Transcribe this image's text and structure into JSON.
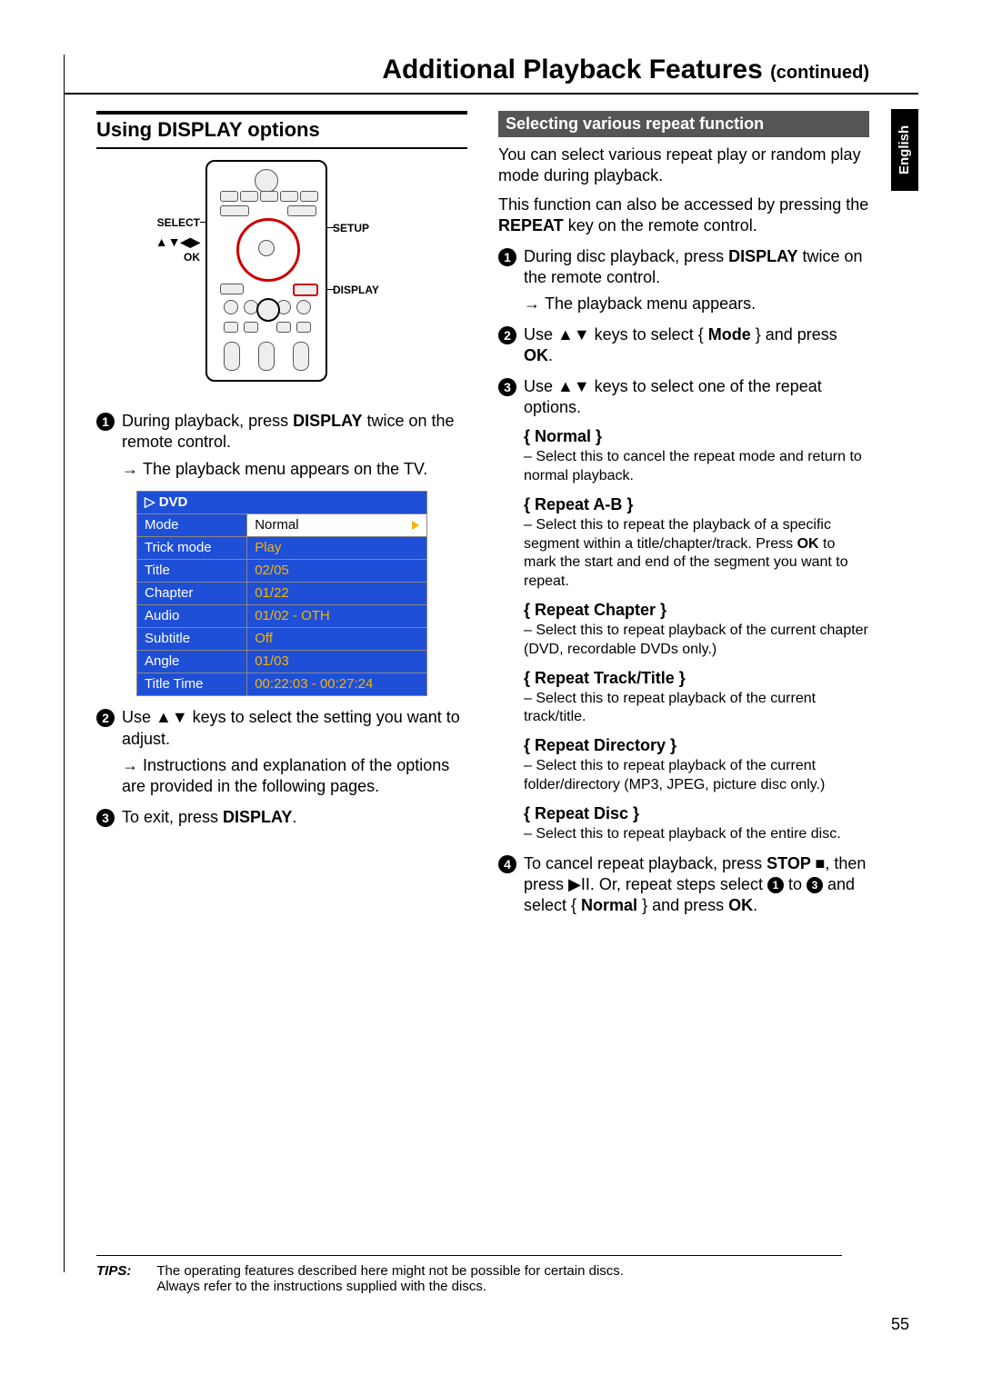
{
  "page": {
    "title": "Additional Playback Features",
    "continued": "(continued)",
    "number": "55",
    "language_tab": "English"
  },
  "left": {
    "section_title": "Using DISPLAY options",
    "remote_labels": {
      "select": "SELECT",
      "arrows": "▲▼◀▶",
      "ok": "OK",
      "setup": "SETUP",
      "display": "DISPLAY"
    },
    "step1_a": "During playback, press ",
    "step1_b": "DISPLAY",
    "step1_c": " twice on the remote control.",
    "step1_res": "The playback menu appears on the TV.",
    "osd": {
      "header": "▷ DVD",
      "rows": [
        {
          "label": "Mode",
          "value": "Normal",
          "selected": true
        },
        {
          "label": "Trick mode",
          "value": "Play"
        },
        {
          "label": "Title",
          "value": "02/05"
        },
        {
          "label": "Chapter",
          "value": "01/22"
        },
        {
          "label": "Audio",
          "value": "01/02 - OTH"
        },
        {
          "label": "Subtitle",
          "value": "Off"
        },
        {
          "label": "Angle",
          "value": "01/03"
        },
        {
          "label": "Title Time",
          "value": "00:22:03 - 00:27:24"
        }
      ]
    },
    "step2": "Use ▲▼ keys to select the setting you want to adjust.",
    "step2_res": "Instructions and explanation of the options are provided in the following pages.",
    "step3_a": "To exit, press ",
    "step3_b": "DISPLAY",
    "step3_c": "."
  },
  "right": {
    "subhead": "Selecting various repeat function",
    "intro1": "You can select various repeat play or random play mode during playback.",
    "intro2_a": "This function can also be accessed by pressing the ",
    "intro2_b": "REPEAT",
    "intro2_c": " key on the remote control.",
    "step1_a": "During disc playback, press ",
    "step1_b": "DISPLAY",
    "step1_c": " twice on the remote control.",
    "step1_res": "The playback menu appears.",
    "step2_a": "Use ▲▼ keys to select { ",
    "step2_b": "Mode",
    "step2_c": " } and press ",
    "step2_d": "OK",
    "step2_e": ".",
    "step3": "Use ▲▼ keys to select one of the repeat options.",
    "opts": [
      {
        "label": "{ Normal }",
        "desc": "– Select this to cancel the repeat mode and return to normal playback."
      },
      {
        "label": "{ Repeat A-B }",
        "desc_a": "– Select this to repeat the playback of a specific segment within a title/chapter/track. Press ",
        "desc_b": "OK",
        "desc_c": " to mark the start and end of the segment you want to repeat."
      },
      {
        "label": "{ Repeat Chapter }",
        "desc": "– Select this to repeat playback of the current chapter (DVD, recordable DVDs only.)"
      },
      {
        "label": "{ Repeat Track/Title }",
        "desc": "– Select this to repeat playback of the current track/title."
      },
      {
        "label": "{ Repeat Directory }",
        "desc": "– Select this to repeat playback of the current folder/directory (MP3, JPEG, picture disc only.)"
      },
      {
        "label": "{ Repeat Disc }",
        "desc": "– Select this to repeat playback of the entire disc."
      }
    ],
    "step4_a": "To cancel repeat playback, press ",
    "step4_b": "STOP ■",
    "step4_c": ", then press ▶II. Or, repeat steps select ",
    "step4_d": " to ",
    "step4_e": " and select { ",
    "step4_f": "Normal",
    "step4_g": " } and press ",
    "step4_h": "OK",
    "step4_i": "."
  },
  "tips": {
    "label": "TIPS:",
    "line1": "The operating features described here might not be possible for certain discs.",
    "line2": "Always refer to the instructions supplied with the discs."
  }
}
